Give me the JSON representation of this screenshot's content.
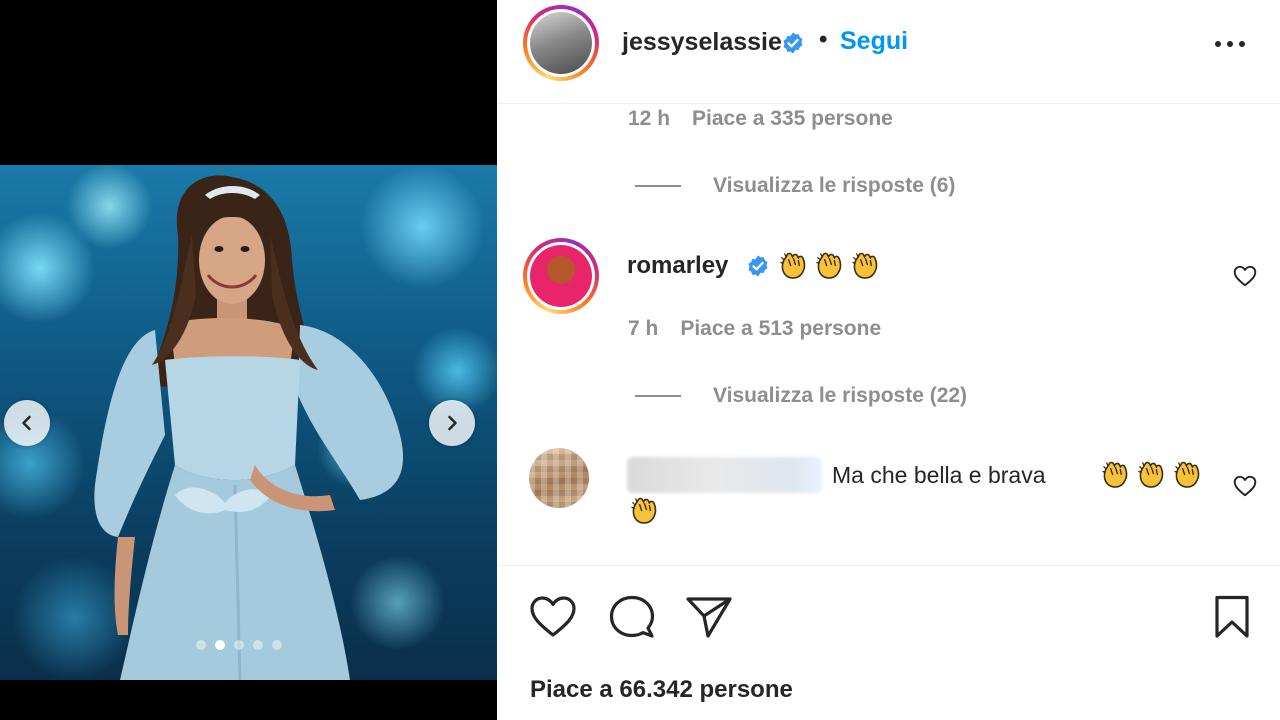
{
  "post": {
    "username": "jessyselassie",
    "verified": true,
    "follow_label": "Segui",
    "separator": "•",
    "more_icon": "more-horizontal-icon"
  },
  "media": {
    "carousel_count": 5,
    "active_index": 1,
    "prev_icon": "chevron-left-icon",
    "next_icon": "chevron-right-icon"
  },
  "comments": [
    {
      "time": "12 h",
      "likes": "Piace a 335 persone",
      "replies": "Visualizza le risposte (6)"
    },
    {
      "username": "romarley",
      "verified": true,
      "emoji": [
        "clapping-hands-icon",
        "clapping-hands-icon",
        "clapping-hands-icon"
      ],
      "time": "7 h",
      "likes": "Piace a 513 persone",
      "replies": "Visualizza le risposte (22)"
    },
    {
      "username_hidden": true,
      "text": "Ma che bella e brava",
      "emoji": [
        "clapping-hands-icon",
        "clapping-hands-icon",
        "clapping-hands-icon",
        "clapping-hands-icon"
      ]
    }
  ],
  "actions": {
    "like_icon": "heart-icon",
    "comment_icon": "comment-icon",
    "share_icon": "send-icon",
    "save_icon": "bookmark-icon",
    "like_count": "Piace a 66.342 persone"
  },
  "colors": {
    "link": "#0095f6",
    "verified": "#3897f0",
    "muted": "#8e8e8e",
    "text": "#262626"
  }
}
